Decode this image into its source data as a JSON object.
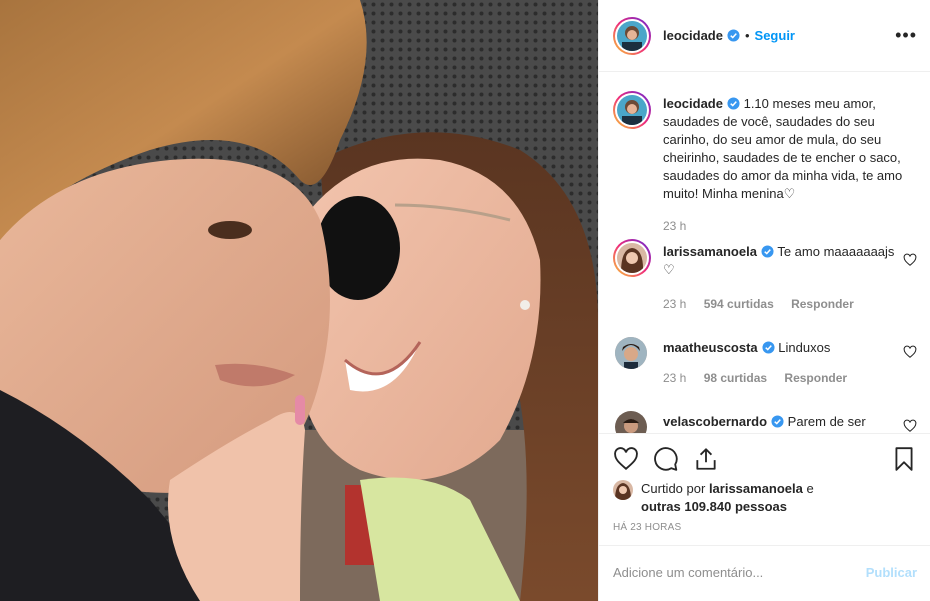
{
  "post": {
    "username": "leocidade",
    "separator": "•",
    "follow_label": "Seguir",
    "more_label": "•••",
    "photo_alt": "selfie"
  },
  "caption": {
    "username": "leocidade",
    "text": "1.10 meses meu amor, saudades de você, saudades do seu carinho, do seu amor de mula, do seu cheirinho, saudades de te encher o saco, saudades do amor da minha vida, te amo muito! Minha menina♡",
    "time": "23 h"
  },
  "comments": [
    {
      "username": "larissamanoela",
      "text": "Te amo maaaaaaajs ♡",
      "time": "23 h",
      "likes": "594 curtidas",
      "reply": "Responder"
    },
    {
      "username": "maatheuscosta",
      "text": "Linduxos",
      "time": "23 h",
      "likes": "98 curtidas",
      "reply": "Responder"
    },
    {
      "username": "velascobernardo",
      "text": "Parem de ser",
      "time": "",
      "likes": "",
      "reply": ""
    }
  ],
  "liked": {
    "prefix": "Curtido por",
    "user": "larissamanoela",
    "mid": "e",
    "others": "outras 109.840 pessoas"
  },
  "timestamp": "HÁ 23 HORAS",
  "add_comment": {
    "placeholder": "Adicione um comentário...",
    "publish": "Publicar"
  },
  "colors": {
    "link": "#0095f6",
    "muted": "#8e8e8e",
    "publish_disabled": "#b2dffc"
  }
}
